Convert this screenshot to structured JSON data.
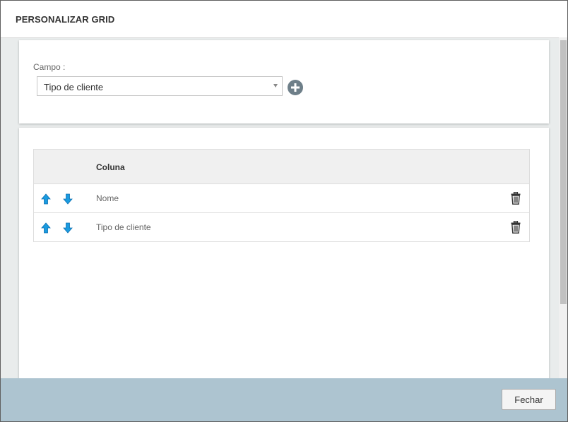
{
  "dialog": {
    "title": "PERSONALIZAR GRID"
  },
  "field": {
    "label": "Campo :",
    "selected_value": "Tipo de cliente"
  },
  "grid": {
    "header": "Coluna",
    "rows": [
      {
        "label": "Nome"
      },
      {
        "label": "Tipo de cliente"
      }
    ]
  },
  "footer": {
    "close_label": "Fechar"
  },
  "icons": {
    "add": "plus-circle-icon",
    "move_up": "arrow-up-icon",
    "move_down": "arrow-down-icon",
    "delete": "trash-icon"
  },
  "colors": {
    "accent_arrow": "#1a9be0",
    "footer_bg": "#adc4d0",
    "add_button": "#6e7f89"
  }
}
